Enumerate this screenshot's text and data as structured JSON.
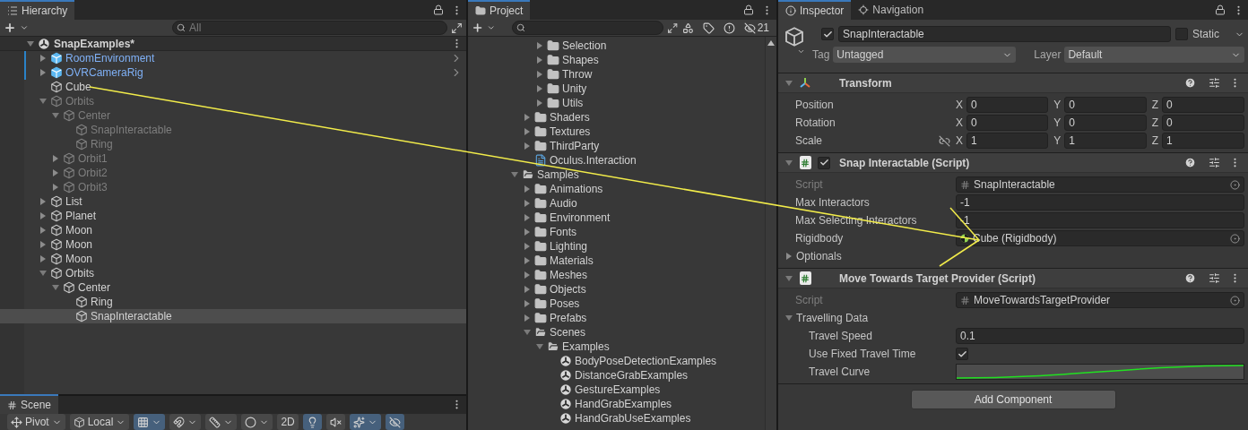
{
  "hierarchy": {
    "tab": "Hierarchy",
    "search": {
      "placeholder": "All"
    },
    "scene": {
      "name": "SnapExamples*",
      "expanded": true
    },
    "items": [
      {
        "name": "RoomEnvironment",
        "kind": "prefab",
        "expandable": true,
        "expanded": false,
        "disabled": false,
        "selected": false
      },
      {
        "name": "OVRCameraRig",
        "kind": "prefab",
        "expandable": true,
        "expanded": false,
        "disabled": false,
        "selected": false
      },
      {
        "name": "Cube",
        "kind": "object",
        "expandable": false,
        "disabled": false,
        "selected": false
      },
      {
        "name": "Orbits",
        "kind": "object",
        "expandable": true,
        "expanded": true,
        "disabled": true,
        "selected": false,
        "children": [
          {
            "name": "Center",
            "kind": "object",
            "expandable": true,
            "expanded": true,
            "disabled": true,
            "selected": false,
            "children": [
              {
                "name": "SnapInteractable",
                "kind": "object",
                "expandable": false,
                "disabled": true,
                "selected": false
              },
              {
                "name": "Ring",
                "kind": "object",
                "expandable": false,
                "disabled": true,
                "selected": false
              }
            ]
          },
          {
            "name": "Orbit1",
            "kind": "object",
            "expandable": true,
            "expanded": false,
            "disabled": true,
            "selected": false
          },
          {
            "name": "Orbit2",
            "kind": "object",
            "expandable": true,
            "expanded": false,
            "disabled": true,
            "selected": false
          },
          {
            "name": "Orbit3",
            "kind": "object",
            "expandable": true,
            "expanded": false,
            "disabled": true,
            "selected": false
          }
        ]
      },
      {
        "name": "List",
        "kind": "object",
        "expandable": true,
        "expanded": false,
        "disabled": false,
        "selected": false
      },
      {
        "name": "Planet",
        "kind": "object",
        "expandable": true,
        "expanded": false,
        "disabled": false,
        "selected": false
      },
      {
        "name": "Moon",
        "kind": "object",
        "expandable": true,
        "expanded": false,
        "disabled": false,
        "selected": false
      },
      {
        "name": "Moon",
        "kind": "object",
        "expandable": true,
        "expanded": false,
        "disabled": false,
        "selected": false
      },
      {
        "name": "Moon",
        "kind": "object",
        "expandable": true,
        "expanded": false,
        "disabled": false,
        "selected": false
      },
      {
        "name": "Orbits",
        "kind": "object",
        "expandable": true,
        "expanded": true,
        "disabled": false,
        "selected": false,
        "children": [
          {
            "name": "Center",
            "kind": "object",
            "expandable": true,
            "expanded": true,
            "disabled": false,
            "selected": false,
            "children": [
              {
                "name": "Ring",
                "kind": "object",
                "expandable": false,
                "disabled": false,
                "selected": false
              },
              {
                "name": "SnapInteractable",
                "kind": "object",
                "expandable": false,
                "disabled": false,
                "selected": true
              }
            ]
          }
        ]
      }
    ]
  },
  "scene_view": {
    "tab": "Scene",
    "tools": [
      {
        "kind": "pivot",
        "label": "Pivot",
        "on": false,
        "dropdown": true
      },
      {
        "kind": "space",
        "label": "Local",
        "on": false,
        "dropdown": true
      },
      {
        "kind": "grid",
        "on": true,
        "dropdown": true
      },
      {
        "kind": "snap",
        "on": false,
        "dropdown": true
      },
      {
        "kind": "increment",
        "on": false,
        "dropdown": true
      },
      {
        "kind": "shading",
        "on": false,
        "dropdown": true
      },
      {
        "kind": "mode",
        "label": "2D",
        "on": false,
        "dropdown": false
      },
      {
        "kind": "lighting",
        "on": true,
        "dropdown": false
      },
      {
        "kind": "audio",
        "on": false,
        "dropdown": false
      },
      {
        "kind": "effects",
        "on": true,
        "dropdown": true
      },
      {
        "kind": "visibility",
        "on": true,
        "dropdown": false
      }
    ]
  },
  "project": {
    "tab": "Project",
    "hidden_count": "21",
    "tree": [
      {
        "children": [
          {
            "children": [
              {
                "name": "Selection",
                "kind": "folder",
                "expandable": true,
                "expanded": false
              },
              {
                "name": "Shapes",
                "kind": "folder",
                "expandable": true,
                "expanded": false
              },
              {
                "name": "Throw",
                "kind": "folder",
                "expandable": true,
                "expanded": false
              },
              {
                "name": "Unity",
                "kind": "folder",
                "expandable": true,
                "expanded": false
              },
              {
                "name": "Utils",
                "kind": "folder",
                "expandable": true,
                "expanded": false
              }
            ]
          },
          {
            "name": "Shaders",
            "kind": "folder",
            "expandable": true,
            "expanded": false
          },
          {
            "name": "Textures",
            "kind": "folder",
            "expandable": true,
            "expanded": false
          },
          {
            "name": "ThirdParty",
            "kind": "folder",
            "expandable": true,
            "expanded": false
          },
          {
            "name": "Oculus.Interaction",
            "kind": "assembly",
            "expandable": false
          }
        ]
      },
      {
        "name": "Samples",
        "kind": "folder",
        "expandable": true,
        "expanded": true,
        "children": [
          {
            "name": "Animations",
            "kind": "folder",
            "expandable": true,
            "expanded": false
          },
          {
            "name": "Audio",
            "kind": "folder",
            "expandable": true,
            "expanded": false
          },
          {
            "name": "Environment",
            "kind": "folder",
            "expandable": true,
            "expanded": false
          },
          {
            "name": "Fonts",
            "kind": "folder",
            "expandable": true,
            "expanded": false
          },
          {
            "name": "Lighting",
            "kind": "folder",
            "expandable": true,
            "expanded": false
          },
          {
            "name": "Materials",
            "kind": "folder",
            "expandable": true,
            "expanded": false
          },
          {
            "name": "Meshes",
            "kind": "folder",
            "expandable": true,
            "expanded": false
          },
          {
            "name": "Objects",
            "kind": "folder",
            "expandable": true,
            "expanded": false
          },
          {
            "name": "Poses",
            "kind": "folder",
            "expandable": true,
            "expanded": false
          },
          {
            "name": "Prefabs",
            "kind": "folder",
            "expandable": true,
            "expanded": false
          },
          {
            "name": "Scenes",
            "kind": "folder",
            "expandable": true,
            "expanded": true,
            "children": [
              {
                "name": "Examples",
                "kind": "folder",
                "expandable": true,
                "expanded": true,
                "children": [
                  {
                    "name": "BodyPoseDetectionExamples",
                    "kind": "scene",
                    "expandable": false
                  },
                  {
                    "name": "DistanceGrabExamples",
                    "kind": "scene",
                    "expandable": false
                  },
                  {
                    "name": "GestureExamples",
                    "kind": "scene",
                    "expandable": false
                  },
                  {
                    "name": "HandGrabExamples",
                    "kind": "scene",
                    "expandable": false
                  },
                  {
                    "name": "HandGrabUseExamples",
                    "kind": "scene",
                    "expandable": false
                  }
                ]
              }
            ]
          }
        ]
      }
    ]
  },
  "inspector": {
    "tabs": [
      {
        "label": "Inspector",
        "kind": "info",
        "selected": true
      },
      {
        "label": "Navigation",
        "kind": "navigation",
        "selected": false
      }
    ],
    "object": {
      "active": true,
      "name": "SnapInteractable",
      "static": false,
      "static_label": "Static",
      "tag_label": "Tag",
      "tag": "Untagged",
      "layer_label": "Layer",
      "layer": "Default"
    },
    "components": [
      {
        "title": "Transform",
        "kind": "transform",
        "expanded": true,
        "rows": [
          {
            "label": "Position",
            "kind": "vector3",
            "disabled": false,
            "axes": [
              {
                "axis": "X",
                "value": "0"
              },
              {
                "axis": "Y",
                "value": "0"
              },
              {
                "axis": "Z",
                "value": "0"
              }
            ]
          },
          {
            "label": "Rotation",
            "kind": "vector3",
            "disabled": false,
            "axes": [
              {
                "axis": "X",
                "value": "0"
              },
              {
                "axis": "Y",
                "value": "0"
              },
              {
                "axis": "Z",
                "value": "0"
              }
            ]
          },
          {
            "label": "Scale",
            "kind": "vector3",
            "disabled": false,
            "linked": false,
            "axes": [
              {
                "axis": "X",
                "value": "1"
              },
              {
                "axis": "Y",
                "value": "1"
              },
              {
                "axis": "Z",
                "value": "1"
              }
            ]
          }
        ]
      },
      {
        "title": "Snap Interactable (Script)",
        "kind": "script",
        "enabled": true,
        "expanded": true,
        "rows": [
          {
            "label": "Script",
            "kind": "script",
            "value": "SnapInteractable",
            "disabled": true
          },
          {
            "label": "Max Interactors",
            "kind": "text",
            "value": "-1",
            "disabled": false
          },
          {
            "label": "Max Selecting Interactors",
            "kind": "text",
            "value": "-1",
            "disabled": false
          },
          {
            "label": "Rigidbody",
            "kind": "object",
            "value": "Cube (Rigidbody)",
            "disabled": false
          },
          {
            "label": "Optionals",
            "kind": "foldout",
            "expanded": false,
            "disabled": false
          }
        ]
      },
      {
        "title": "Move Towards Target Provider (Script)",
        "kind": "script",
        "expanded": true,
        "rows": [
          {
            "label": "Script",
            "kind": "script",
            "value": "MoveTowardsTargetProvider",
            "disabled": true
          },
          {
            "label": "Travelling Data",
            "kind": "foldout",
            "expanded": true,
            "disabled": false,
            "children": [
              {
                "label": "Travel Speed",
                "kind": "text",
                "value": "0.1",
                "disabled": false
              },
              {
                "label": "Use Fixed Travel Time",
                "kind": "checkbox",
                "checked": true,
                "disabled": false
              },
              {
                "label": "Travel Curve",
                "kind": "curve",
                "disabled": false
              }
            ]
          }
        ]
      }
    ],
    "add_component": "Add Component"
  }
}
